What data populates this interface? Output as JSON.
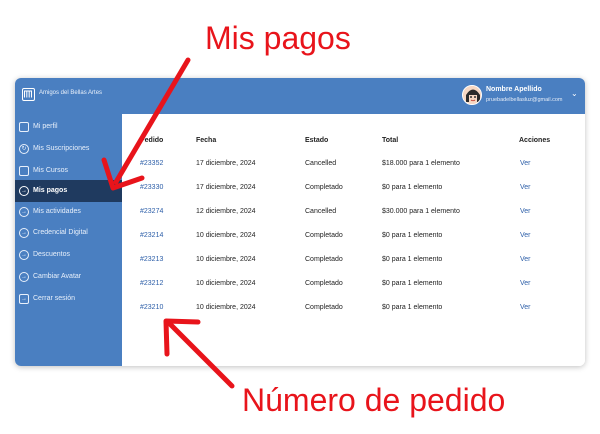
{
  "site_name": "Amigos del Bellas Artes",
  "user": {
    "name": "Nombre Apellido",
    "email": "pruebadelbellasluz@gmail.com"
  },
  "sidebar": {
    "items": [
      {
        "label": "Mi perfil",
        "icon": "user-icon"
      },
      {
        "label": "Mis Suscripciones",
        "icon": "sync-icon"
      },
      {
        "label": "Mis Cursos",
        "icon": "tag-icon"
      },
      {
        "label": "Mis pagos",
        "icon": "arrow-circle-icon",
        "active": true
      },
      {
        "label": "Mis actividades",
        "icon": "arrow-circle-icon"
      },
      {
        "label": "Credencial Digital",
        "icon": "arrow-circle-icon"
      },
      {
        "label": "Descuentos",
        "icon": "arrow-circle-icon"
      },
      {
        "label": "Cambiar Avatar",
        "icon": "arrow-circle-icon"
      },
      {
        "label": "Cerrar sesión",
        "icon": "logout-icon"
      }
    ]
  },
  "table": {
    "headers": [
      "Pedido",
      "Fecha",
      "Estado",
      "Total",
      "Acciones"
    ],
    "rows": [
      {
        "pedido": "#23352",
        "fecha": "17 diciembre, 2024",
        "estado": "Cancelled",
        "total": "$18.000 para 1 elemento",
        "accion": "Ver"
      },
      {
        "pedido": "#23330",
        "fecha": "17 diciembre, 2024",
        "estado": "Completado",
        "total": "$0 para 1 elemento",
        "accion": "Ver"
      },
      {
        "pedido": "#23274",
        "fecha": "12 diciembre, 2024",
        "estado": "Cancelled",
        "total": "$30.000 para 1 elemento",
        "accion": "Ver"
      },
      {
        "pedido": "#23214",
        "fecha": "10 diciembre, 2024",
        "estado": "Completado",
        "total": "$0 para 1 elemento",
        "accion": "Ver"
      },
      {
        "pedido": "#23213",
        "fecha": "10 diciembre, 2024",
        "estado": "Completado",
        "total": "$0 para 1 elemento",
        "accion": "Ver"
      },
      {
        "pedido": "#23212",
        "fecha": "10 diciembre, 2024",
        "estado": "Completado",
        "total": "$0 para 1 elemento",
        "accion": "Ver"
      },
      {
        "pedido": "#23210",
        "fecha": "10 diciembre, 2024",
        "estado": "Completado",
        "total": "$0 para 1 elemento",
        "accion": "Ver"
      }
    ]
  },
  "annotations": {
    "top": "Mis pagos",
    "bottom": "Número de pedido"
  },
  "colors": {
    "brand": "#4a7fc1",
    "active": "#1f3a5f",
    "link": "#2c5ea8",
    "annotation": "#e8141b"
  }
}
